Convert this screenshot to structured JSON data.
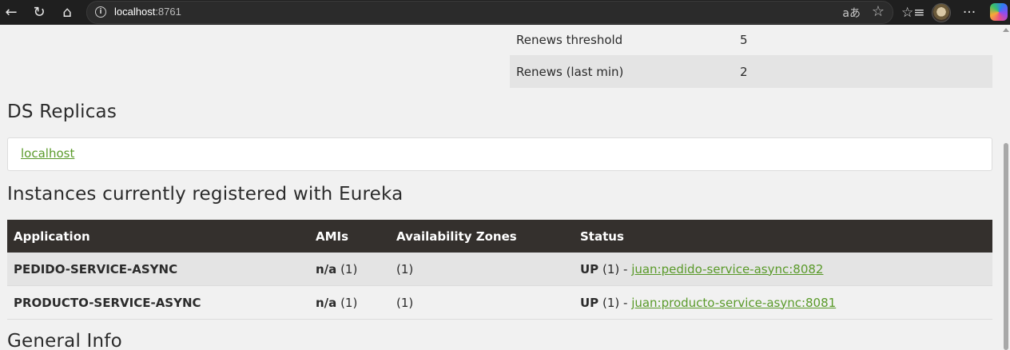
{
  "browser": {
    "url_host": "localhost",
    "url_port": ":8761"
  },
  "stats": [
    {
      "key": "Renews threshold",
      "value": "5"
    },
    {
      "key": "Renews (last min)",
      "value": "2"
    }
  ],
  "replicas": {
    "heading": "DS Replicas",
    "link": "localhost"
  },
  "instances": {
    "heading": "Instances currently registered with Eureka",
    "columns": [
      "Application",
      "AMIs",
      "Availability Zones",
      "Status"
    ],
    "rows": [
      {
        "application": "PEDIDO-SERVICE-ASYNC",
        "ami": "n/a",
        "ami_count": "(1)",
        "zones": "(1)",
        "status": "UP",
        "status_count": "(1) -",
        "instance_link": "juan:pedido-service-async:8082"
      },
      {
        "application": "PRODUCTO-SERVICE-ASYNC",
        "ami": "n/a",
        "ami_count": "(1)",
        "zones": "(1)",
        "status": "UP",
        "status_count": "(1) -",
        "instance_link": "juan:producto-service-async:8081"
      }
    ]
  },
  "general_info": {
    "heading": "General Info"
  },
  "colors": {
    "link": "#5a9a2a",
    "table_header_bg": "#34302d",
    "page_bg": "#f1f1f1"
  }
}
